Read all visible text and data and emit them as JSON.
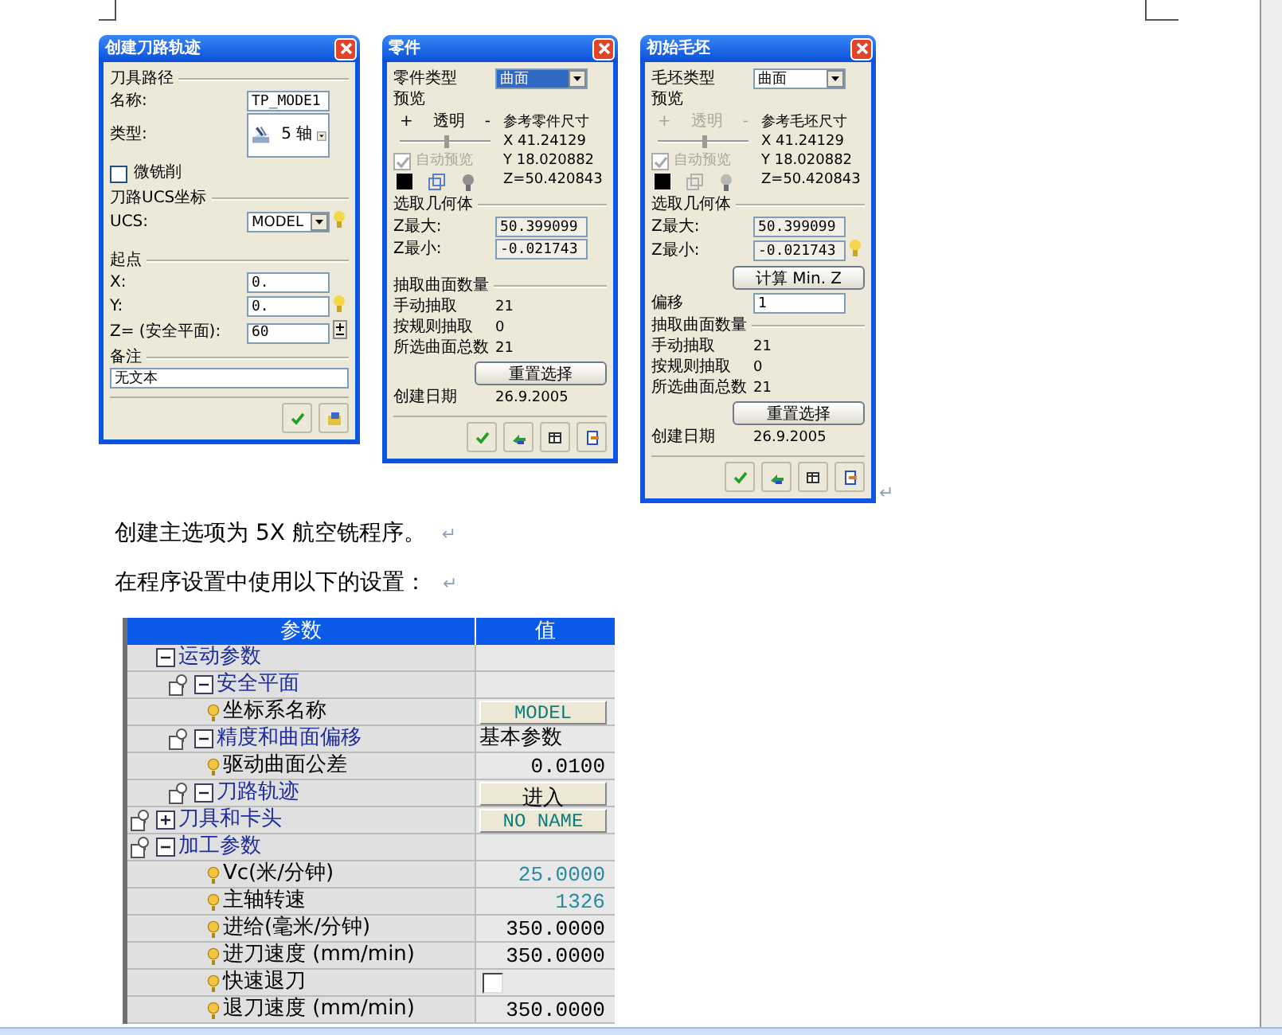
{
  "figure": {
    "mark": "↵",
    "dialogs": [
      {
        "title": "创建刀路轨迹",
        "kind": "setup",
        "rows": [
          {
            "kind": "section",
            "label": "刀具路径"
          },
          {
            "kind": "field",
            "label": "名称:",
            "value": "TP_MODE1"
          },
          {
            "kind": "type",
            "label": "类型:",
            "value": "5 轴"
          },
          {
            "kind": "check",
            "label": "微铣削",
            "checked": false
          },
          {
            "kind": "section",
            "label": "刀路UCS坐标"
          },
          {
            "kind": "select",
            "label": "UCS:",
            "value": "MODEL",
            "highlighted": false,
            "pin": true
          },
          {
            "kind": "spacer"
          },
          {
            "kind": "section",
            "label": "起点"
          },
          {
            "kind": "field",
            "label": "X:",
            "value": "0."
          },
          {
            "kind": "field",
            "label": "Y:",
            "value": "0.",
            "pin": true
          },
          {
            "kind": "field",
            "label": "Z= (安全平面):",
            "value": "60",
            "spin": true
          },
          {
            "kind": "section",
            "label": "备注"
          },
          {
            "kind": "note",
            "value": "无文本"
          },
          {
            "kind": "actions"
          }
        ]
      },
      {
        "title": "零件",
        "kind": "geometry",
        "rows": [
          {
            "kind": "select",
            "label": "零件类型",
            "value": "曲面",
            "highlighted": true
          },
          {
            "kind": "preview",
            "title": "预览",
            "plus": "+",
            "caption": "透明",
            "minus": "-",
            "level": 0.5,
            "disabled": false,
            "auto_label": "自动预览",
            "auto_checked": true,
            "ref_title": "参考零件尺寸",
            "ref_values": [
              "X 41.24129",
              "Y 18.020882",
              "Z=50.420843"
            ]
          },
          {
            "kind": "section",
            "label": "选取几何体"
          },
          {
            "kind": "field",
            "label": "Z最大:",
            "value": "50.399099",
            "readonly": true
          },
          {
            "kind": "field",
            "label": "Z最小:",
            "value": "-0.021743",
            "readonly": true
          },
          {
            "kind": "spacer"
          },
          {
            "kind": "section",
            "label": "抽取曲面数量"
          },
          {
            "kind": "text",
            "label": "手动抽取",
            "value": "21"
          },
          {
            "kind": "text",
            "label": "按规则抽取",
            "value": "0"
          },
          {
            "kind": "text",
            "label": "所选曲面总数",
            "value": "21"
          },
          {
            "kind": "button",
            "label": "重置选择"
          },
          {
            "kind": "text",
            "label": "创建日期",
            "value": "26.9.2005"
          },
          {
            "kind": "actions"
          }
        ]
      },
      {
        "title": "初始毛坯",
        "kind": "geometry",
        "rows": [
          {
            "kind": "select",
            "label": "毛坯类型",
            "value": "曲面",
            "highlighted": false
          },
          {
            "kind": "preview",
            "title": "预览",
            "plus": "+",
            "caption": "透明",
            "minus": "-",
            "level": 0.5,
            "disabled": true,
            "auto_label": "自动预览",
            "auto_checked": true,
            "ref_title": "参考毛坯尺寸",
            "ref_values": [
              "X 41.24129",
              "Y 18.020882",
              "Z=50.420843"
            ]
          },
          {
            "kind": "section",
            "label": "选取几何体"
          },
          {
            "kind": "field",
            "label": "Z最大:",
            "value": "50.399099",
            "readonly": true
          },
          {
            "kind": "field",
            "label": "Z最小:",
            "value": "-0.021743",
            "readonly": true,
            "pin": true
          },
          {
            "kind": "button",
            "label": "计算 Min. Z"
          },
          {
            "kind": "field",
            "label": "偏移",
            "value": "1"
          },
          {
            "kind": "section",
            "label": "抽取曲面数量"
          },
          {
            "kind": "text",
            "label": "手动抽取",
            "value": "21"
          },
          {
            "kind": "text",
            "label": "按规则抽取",
            "value": "0"
          },
          {
            "kind": "text",
            "label": "所选曲面总数",
            "value": "21"
          },
          {
            "kind": "button",
            "label": "重置选择"
          },
          {
            "kind": "text",
            "label": "创建日期",
            "value": "26.9.2005"
          },
          {
            "kind": "actions"
          }
        ]
      }
    ]
  },
  "paragraphs": [
    {
      "text": "创建主选项为 5X 航空铣程序。",
      "mark": "↵"
    },
    {
      "text": "在程序设置中使用以下的设置：",
      "mark": "↵"
    }
  ],
  "table": {
    "columns": [
      "参数",
      "值"
    ],
    "rows": [
      {
        "kind": "section",
        "label": "运动参数",
        "expanded": true,
        "children": [
          {
            "kind": "group",
            "label": "安全平面",
            "expanded": true,
            "children": [
              {
                "kind": "item",
                "label": "坐标系名称",
                "value": {
                  "kind": "name_button",
                  "text": "MODEL"
                }
              }
            ]
          },
          {
            "kind": "group",
            "label": "精度和曲面偏移",
            "expanded": true,
            "value": {
              "kind": "text",
              "text": "基本参数"
            },
            "children": [
              {
                "kind": "item",
                "label": "驱动曲面公差",
                "value": {
                  "kind": "number",
                  "text": "0.0100"
                }
              }
            ]
          },
          {
            "kind": "group",
            "label": "刀路轨迹",
            "expanded": true,
            "value": {
              "kind": "button",
              "text": "进入"
            }
          }
        ]
      },
      {
        "kind": "group",
        "label": "刀具和卡头",
        "expanded": false,
        "value": {
          "kind": "name_button",
          "text": "NO NAME"
        }
      },
      {
        "kind": "group",
        "label": "加工参数",
        "expanded": true,
        "children": [
          {
            "kind": "item",
            "label": "Vc(米/分钟)",
            "value": {
              "kind": "derived",
              "text": "25.0000"
            }
          },
          {
            "kind": "item",
            "label": "主轴转速",
            "value": {
              "kind": "derived",
              "text": "1326"
            }
          },
          {
            "kind": "item",
            "label": "进给(毫米/分钟)",
            "value": {
              "kind": "number",
              "text": "350.0000"
            }
          },
          {
            "kind": "item",
            "label": "进刀速度 (mm/min)",
            "value": {
              "kind": "number",
              "text": "350.0000"
            }
          },
          {
            "kind": "item",
            "label": "快速退刀",
            "value": {
              "kind": "checkbox",
              "checked": false
            }
          },
          {
            "kind": "item",
            "label": "退刀速度 (mm/min)",
            "value": {
              "kind": "number",
              "text": "350.0000"
            }
          }
        ]
      }
    ]
  }
}
